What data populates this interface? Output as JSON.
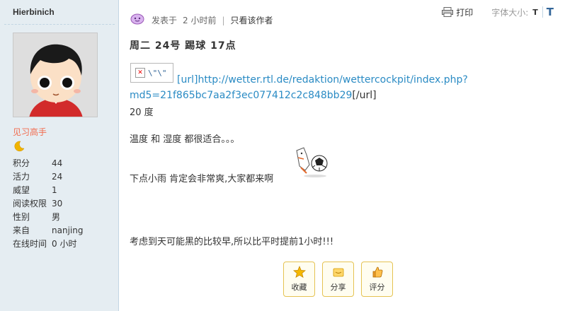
{
  "sidebar": {
    "username": "Hierbinich",
    "rank": "见习高手",
    "stats": [
      {
        "label": "积分",
        "value": "44"
      },
      {
        "label": "活力",
        "value": "24"
      },
      {
        "label": "威望",
        "value": "1"
      },
      {
        "label": "阅读权限",
        "value": "30"
      },
      {
        "label": "性别",
        "value": "男"
      },
      {
        "label": "来自",
        "value": "nanjing"
      },
      {
        "label": "在线时间",
        "value": "0 小时"
      }
    ]
  },
  "post": {
    "posted_label": "发表于",
    "posted_time": "2 小时前",
    "separator": "|",
    "author_only": "只看该作者",
    "print_label": "打印",
    "font_size_label": "字体大小:",
    "font_small": "T",
    "font_large": "T",
    "title": "周二 24号 踢球 17点",
    "broken_image_alt": "\\\"\\\"",
    "url_text_1": "[url]http://wetter.rtl.de/redaktion/wettercockpit/index.php?",
    "url_text_2": "md5=21f865bc7aa2f3ec077412c2c848bb29",
    "url_close": "[/url]",
    "line_temp": "20 度",
    "line_weather": "温度 和 湿度 都很适合。。。",
    "line_rain": "下点小雨 肯定会非常爽,大家都来啊",
    "line_dark": "考虑到天可能黑的比较早,所以比平时提前1小时!!!"
  },
  "actions": [
    {
      "label": "收藏",
      "icon": "star-icon"
    },
    {
      "label": "分享",
      "icon": "share-icon"
    },
    {
      "label": "评分",
      "icon": "thumbs-up-icon"
    }
  ],
  "colors": {
    "link": "#2a8bc4",
    "rank": "#f26c4f",
    "sidebar_bg": "#e5edf2",
    "action_border": "#e5c352"
  }
}
